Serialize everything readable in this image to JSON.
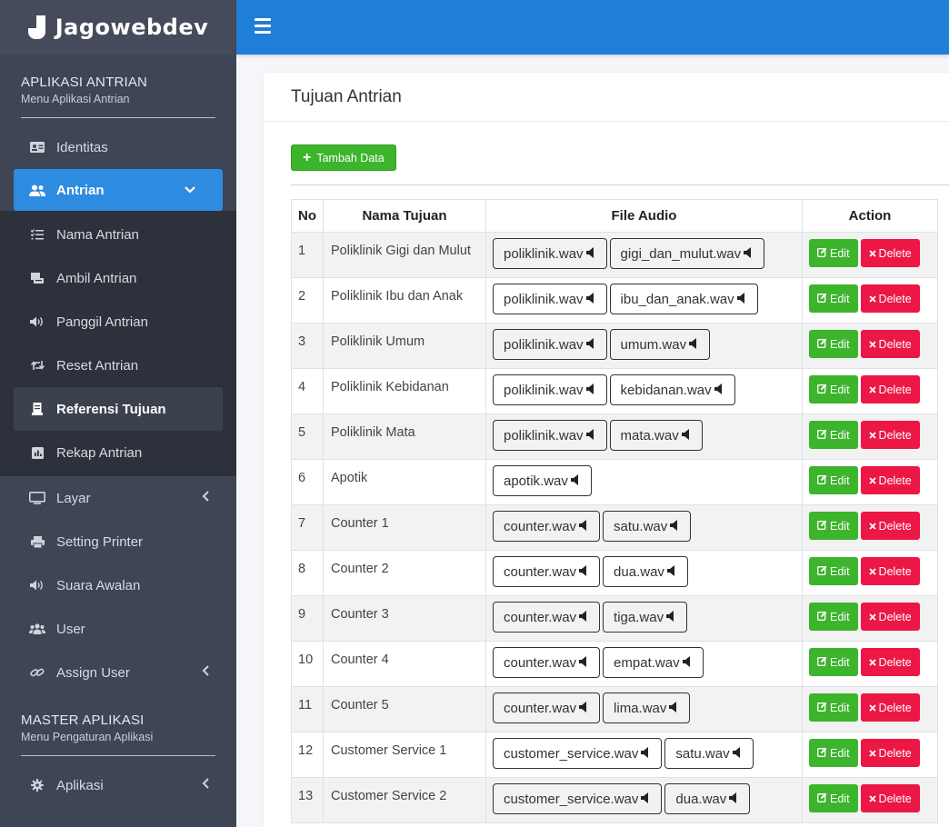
{
  "brand": {
    "name": "Jagowebdev"
  },
  "sidebar": {
    "section1": {
      "title": "APLIKASI ANTRIAN",
      "subtitle": "Menu Aplikasi Antrian"
    },
    "identitas": "Identitas",
    "antrian": "Antrian",
    "submenu": [
      "Nama Antrian",
      "Ambil Antrian",
      "Panggil Antrian",
      "Reset Antrian",
      "Referensi Tujuan",
      "Rekap Antrian"
    ],
    "layar": "Layar",
    "setting_printer": "Setting Printer",
    "suara_awalan": "Suara Awalan",
    "user": "User",
    "assign_user": "Assign User",
    "section2": {
      "title": "MASTER APLIKASI",
      "subtitle": "Menu Pengaturan Aplikasi"
    },
    "aplikasi": "Aplikasi"
  },
  "card": {
    "title": "Tujuan Antrian",
    "add_label": "Tambah Data"
  },
  "table": {
    "headers": {
      "no": "No",
      "name": "Nama Tujuan",
      "audio": "File Audio",
      "action": "Action"
    },
    "edit_label": "Edit",
    "delete_label": "Delete",
    "rows": [
      {
        "no": "1",
        "name": "Poliklinik Gigi dan Mulut",
        "a1": "poliklinik.wav",
        "a2": "gigi_dan_mulut.wav"
      },
      {
        "no": "2",
        "name": "Poliklinik Ibu dan Anak",
        "a1": "poliklinik.wav",
        "a2": "ibu_dan_anak.wav"
      },
      {
        "no": "3",
        "name": "Poliklinik Umum",
        "a1": "poliklinik.wav",
        "a2": "umum.wav"
      },
      {
        "no": "4",
        "name": "Poliklinik Kebidanan",
        "a1": "poliklinik.wav",
        "a2": "kebidanan.wav"
      },
      {
        "no": "5",
        "name": "Poliklinik Mata",
        "a1": "poliklinik.wav",
        "a2": "mata.wav"
      },
      {
        "no": "6",
        "name": "Apotik",
        "a1": "apotik.wav",
        "a2": ""
      },
      {
        "no": "7",
        "name": "Counter 1",
        "a1": "counter.wav",
        "a2": "satu.wav"
      },
      {
        "no": "8",
        "name": "Counter 2",
        "a1": "counter.wav",
        "a2": "dua.wav"
      },
      {
        "no": "9",
        "name": "Counter 3",
        "a1": "counter.wav",
        "a2": "tiga.wav"
      },
      {
        "no": "10",
        "name": "Counter 4",
        "a1": "counter.wav",
        "a2": "empat.wav"
      },
      {
        "no": "11",
        "name": "Counter 5",
        "a1": "counter.wav",
        "a2": "lima.wav"
      },
      {
        "no": "12",
        "name": "Customer Service 1",
        "a1": "customer_service.wav",
        "a2": "satu.wav"
      },
      {
        "no": "13",
        "name": "Customer Service 2",
        "a1": "customer_service.wav",
        "a2": "dua.wav"
      }
    ]
  }
}
